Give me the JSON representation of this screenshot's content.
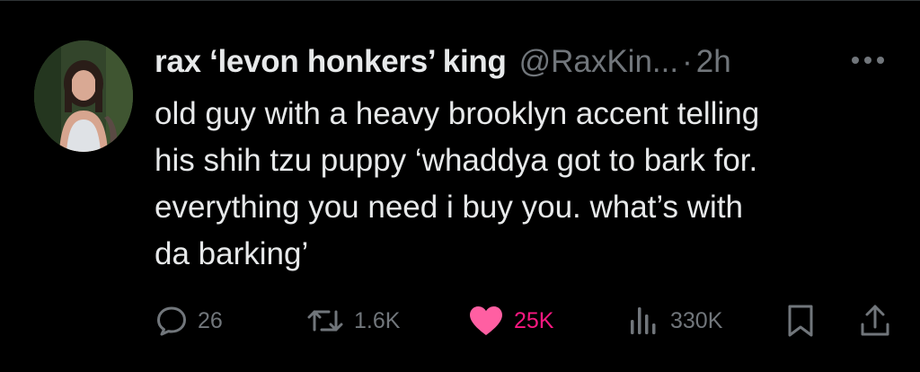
{
  "tweet": {
    "display_name": "rax ‘levon honkers’ king",
    "handle": "@RaxKin...",
    "separator": "·",
    "time": "2h",
    "text_lines": [
      "old guy with a heavy brooklyn accent telling",
      "his shih tzu puppy ‘whaddya got to bark for.",
      "everything you need i buy you. what’s with",
      "da barking’"
    ]
  },
  "actions": {
    "replies": "26",
    "reposts": "1.6K",
    "likes": "25K",
    "views": "330K"
  },
  "icons": {
    "more": "more-icon",
    "reply": "reply-icon",
    "repost": "repost-icon",
    "like": "heart-icon",
    "views": "views-icon",
    "bookmark": "bookmark-icon",
    "share": "share-icon"
  },
  "colors": {
    "background": "#000000",
    "text": "#e7e9ea",
    "secondary": "#71767b",
    "like_active": "#ff5fa2"
  }
}
